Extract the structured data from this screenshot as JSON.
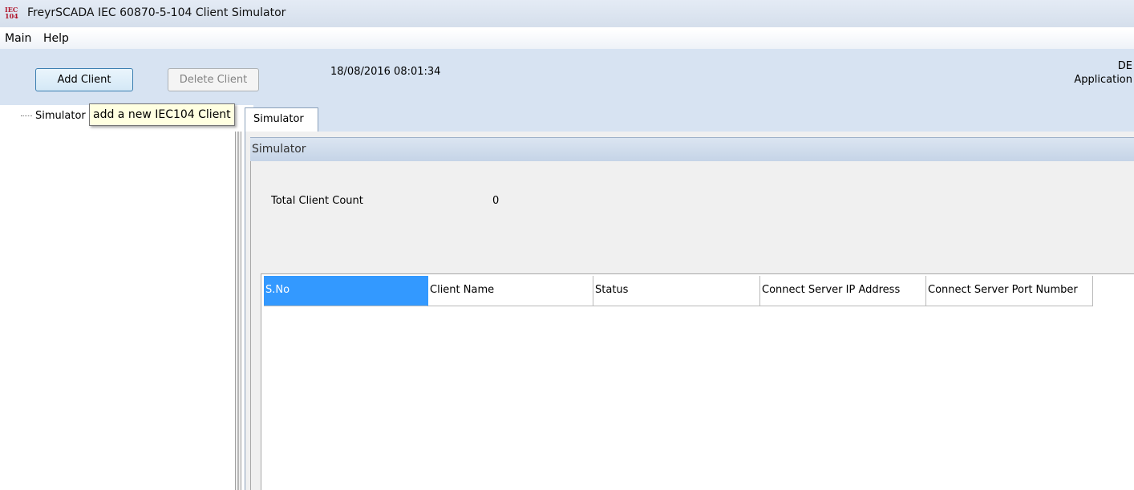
{
  "window": {
    "title": "FreyrSCADA IEC 60870-5-104 Client Simulator",
    "icon_text": "IEC 104",
    "icon_color": "#b0142a"
  },
  "menu": {
    "items": [
      {
        "label": "Main"
      },
      {
        "label": "Help"
      }
    ]
  },
  "toolbar": {
    "add_client_label": "Add Client",
    "delete_client_label": "Delete Client",
    "datetime": "18/08/2016 08:01:34",
    "right_line1": "DE",
    "right_line2": "Application"
  },
  "tooltip": {
    "text": "add a new IEC104 Client"
  },
  "tree": {
    "root_label": "Simulator"
  },
  "tab": {
    "label": "Simulator"
  },
  "panel": {
    "header": "Simulator",
    "total_client_count_label": "Total Client Count",
    "total_client_count_value": "0"
  },
  "grid": {
    "columns": [
      {
        "label": "S.No"
      },
      {
        "label": "Client Name"
      },
      {
        "label": "Status"
      },
      {
        "label": "Connect Server IP Address"
      },
      {
        "label": "Connect Server Port Number"
      }
    ],
    "rows": [],
    "selected_header_color": "#3399ff"
  }
}
